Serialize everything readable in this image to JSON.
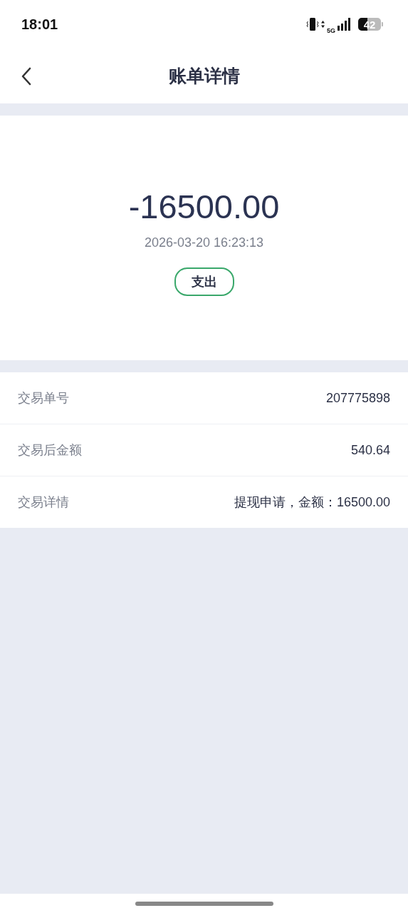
{
  "status_bar": {
    "time": "18:01",
    "network": "5G",
    "battery": "42"
  },
  "header": {
    "title": "账单详情"
  },
  "summary": {
    "amount": "-16500.00",
    "datetime": "2026-03-20 16:23:13",
    "tag": "支出"
  },
  "details": [
    {
      "label": "交易单号",
      "value": "207775898"
    },
    {
      "label": "交易后金额",
      "value": "540.64"
    },
    {
      "label": "交易详情",
      "value": "提现申请，金额：16500.00"
    }
  ]
}
